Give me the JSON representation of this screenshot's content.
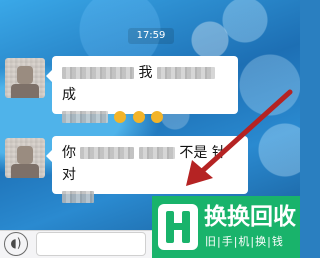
{
  "status": {
    "time": "17:59"
  },
  "messages": [
    {
      "sender": "contact",
      "visible_text": [
        "我",
        "成"
      ]
    },
    {
      "sender": "contact",
      "visible_text": [
        "你",
        "不是",
        "针对"
      ]
    }
  ],
  "input_bar": {
    "voice_icon": "voice-icon"
  },
  "watermark": {
    "title": "换换回收",
    "subtitle": "旧|手|机|换|钱",
    "icon": "hh-logo-icon"
  },
  "annotation": {
    "icon": "red-arrow-icon",
    "color": "#b52323"
  },
  "colors": {
    "bubble": "#ffffff",
    "logo_green": "#19b36b"
  }
}
